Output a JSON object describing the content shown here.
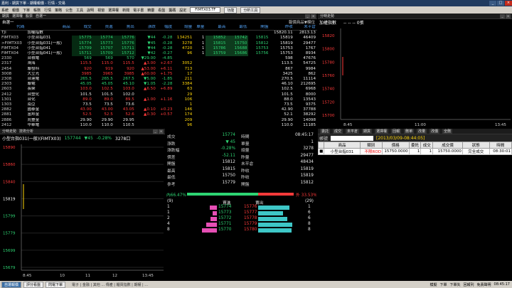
{
  "titlebar": {
    "title": "嘉利 - 期貨下單 - 期權報價 - 行情 - 交易"
  },
  "menubar": {
    "items": [
      "系統",
      "報價",
      "下單",
      "帳務",
      "行情",
      "策略",
      "公告",
      "工具",
      "說明",
      "視窗",
      "選擇權",
      "新聞",
      "電子書",
      "精靈",
      "看盤",
      "籌碼",
      "設定"
    ],
    "symbol": "FIMTX03.TF",
    "btn_a": "功能",
    "btn_b": "分析工具"
  },
  "quote": {
    "tabs": [
      "期貨",
      "選擇權",
      "股票",
      "自選一"
    ],
    "group": "自選一",
    "right_label": "報價商品▼欄位",
    "columns": [
      "代碼",
      "商品",
      "成交",
      "買進",
      "賣出",
      "漲跌",
      "幅度",
      "總量",
      "單量",
      "最高",
      "最低",
      "開盤",
      "昨收",
      "未平倉"
    ],
    "rows": [
      {
        "code": "TJI",
        "name": "加權指數",
        "price": "",
        "bid": "",
        "ask": "",
        "chg": "",
        "pct": "",
        "vol": "",
        "sv": "",
        "high": "",
        "low": "",
        "open": "",
        "prev": "15820.11",
        "oi": "2813.13",
        "cls": "wh",
        "hl": false
      },
      {
        "code": "FIMTX03",
        "name": "小型台指031",
        "price": "15775",
        "bid": "15774",
        "ask": "15776",
        "chg": "▼44",
        "pct": "-0.28",
        "vol": "134251",
        "sv": "1",
        "high": "15852",
        "low": "15742",
        "open": "15815",
        "prev": "15819",
        "oi": "46409",
        "cls": "dn",
        "hl": true
      },
      {
        "code": ">FIMTX03",
        "name": "小型台指031(一般)",
        "price": "15774",
        "bid": "15773",
        "ask": "15776",
        "chg": "▼45",
        "pct": "-0.28",
        "vol": "3278",
        "sv": "1",
        "high": "15815",
        "low": "15750",
        "open": "15812",
        "prev": "15819",
        "oi": "29477",
        "cls": "dn",
        "hl": true
      },
      {
        "code": "FIMTX04",
        "name": "小型台指041",
        "price": "15709",
        "bid": "15707",
        "ask": "15711",
        "chg": "▼44",
        "pct": "-0.28",
        "vol": "4720",
        "sv": "1",
        "high": "15786",
        "low": "15688",
        "open": "15753",
        "prev": "15753",
        "oi": "1767",
        "cls": "dn",
        "hl": true
      },
      {
        "code": "FIMTX04",
        "name": "小型台指041(一般)",
        "price": "15711",
        "bid": "15709",
        "ask": "15712",
        "chg": "▼42",
        "pct": "-0.27",
        "vol": "96",
        "sv": "1",
        "high": "15759",
        "low": "15686",
        "open": "15756",
        "prev": "15753",
        "oi": "8934",
        "cls": "dn",
        "hl": true
      },
      {
        "code": "2330",
        "name": "台積電",
        "price": "569",
        "bid": "569",
        "ask": "570",
        "chg": "▼29.00",
        "pct": "-4.85",
        "vol": "",
        "sv": "",
        "high": "",
        "low": "",
        "open": "",
        "prev": "598",
        "oi": "47676",
        "cls": "dn",
        "hl": false
      },
      {
        "code": "2317",
        "name": "鴻海",
        "price": "115.5",
        "bid": "115.0",
        "ask": "115.5",
        "chg": "▲3.00",
        "pct": "+2.67",
        "vol": "3052",
        "sv": "",
        "high": "",
        "low": "",
        "open": "",
        "prev": "113.5",
        "oi": "54725",
        "cls": "up",
        "hl": false
      },
      {
        "code": "2454",
        "name": "聯發科",
        "price": "920",
        "bid": "919",
        "ask": "920",
        "chg": "▲53.00",
        "pct": "+6.11",
        "vol": "713",
        "sv": "",
        "high": "",
        "low": "",
        "open": "",
        "prev": "867",
        "oi": "9984",
        "cls": "up",
        "hl": false
      },
      {
        "code": "3008",
        "name": "大立光",
        "price": "3985",
        "bid": "3965",
        "ask": "3985",
        "chg": "▲60.00",
        "pct": "+1.75",
        "vol": "17",
        "sv": "",
        "high": "",
        "low": "",
        "open": "",
        "prev": "3425",
        "oi": "862",
        "cls": "up",
        "hl": false
      },
      {
        "code": "2308",
        "name": "台達電",
        "price": "265.5",
        "bid": "265.5",
        "ask": "267.5",
        "chg": "▼5.00",
        "pct": "-1.85",
        "vol": "211",
        "sv": "",
        "high": "",
        "low": "",
        "open": "",
        "prev": "270.5",
        "oi": "11114",
        "cls": "dn",
        "hl": false
      },
      {
        "code": "2303",
        "name": "聯電",
        "price": "45.05",
        "bid": "45.05",
        "ask": "45.10",
        "chg": "▼1.05",
        "pct": "-2.28",
        "vol": "3384",
        "sv": "",
        "high": "",
        "low": "",
        "open": "",
        "prev": "46.10",
        "oi": "212695",
        "cls": "dn",
        "hl": false
      },
      {
        "code": "2603",
        "name": "長榮",
        "price": "103.0",
        "bid": "102.5",
        "ask": "103.0",
        "chg": "▲6.50",
        "pct": "+6.89",
        "vol": "63",
        "sv": "",
        "high": "",
        "low": "",
        "open": "",
        "prev": "102.5",
        "oi": "6968",
        "cls": "up",
        "hl": false
      },
      {
        "code": "2412",
        "name": "台塑化",
        "price": "101.5",
        "bid": "101.5",
        "ask": "102.0",
        "chg": "",
        "pct": "",
        "vol": "29",
        "sv": "",
        "high": "",
        "low": "",
        "open": "",
        "prev": "101.5",
        "oi": "8000",
        "cls": "wh",
        "hl": false
      },
      {
        "code": "1301",
        "name": "台化",
        "price": "89.0",
        "bid": "89.0",
        "ask": "89.5",
        "chg": "▲1.00",
        "pct": "+1.16",
        "vol": "106",
        "sv": "",
        "high": "",
        "low": "",
        "open": "",
        "prev": "88.0",
        "oi": "13543",
        "cls": "up",
        "hl": false
      },
      {
        "code": "1303",
        "name": "南亞",
        "price": "73.5",
        "bid": "73.5",
        "ask": "73.6",
        "chg": "",
        "pct": "",
        "vol": "1",
        "sv": "",
        "high": "",
        "low": "",
        "open": "",
        "prev": "73.5",
        "oi": "9375",
        "cls": "wh",
        "hl": false
      },
      {
        "code": "2882",
        "name": "國泰金",
        "price": "43.00",
        "bid": "43.00",
        "ask": "43.05",
        "chg": "▲0.10",
        "pct": "+0.23",
        "vol": "146",
        "sv": "",
        "high": "",
        "low": "",
        "open": "",
        "prev": "42.90",
        "oi": "37788",
        "cls": "up",
        "hl": false
      },
      {
        "code": "2881",
        "name": "富邦金",
        "price": "52.5",
        "bid": "52.5",
        "ask": "52.6",
        "chg": "▲0.30",
        "pct": "+0.57",
        "vol": "174",
        "sv": "",
        "high": "",
        "low": "",
        "open": "",
        "prev": "52.1",
        "oi": "38292",
        "cls": "up",
        "hl": false
      },
      {
        "code": "2886",
        "name": "兆豐金",
        "price": "29.90",
        "bid": "29.90",
        "ask": "29.95",
        "chg": "",
        "pct": "",
        "vol": "209",
        "sv": "",
        "high": "",
        "low": "",
        "open": "",
        "prev": "29.90",
        "oi": "14098",
        "cls": "wh",
        "hl": false
      },
      {
        "code": "2412",
        "name": "中華電",
        "price": "110.0",
        "bid": "110.0",
        "ask": "110.5",
        "chg": "",
        "pct": "",
        "vol": "96",
        "sv": "",
        "high": "",
        "low": "",
        "open": "",
        "prev": "110.0",
        "oi": "11185",
        "cls": "wh",
        "hl": false
      }
    ]
  },
  "toppanel": {
    "tab": "分時走勢",
    "name": "加權指數",
    "values": "-- -- -- 0張",
    "ylabels": [
      "15820",
      "15800",
      "15780",
      "15760",
      "15740",
      "15720",
      "15700"
    ],
    "xlabels": [
      "8:45",
      "11:00",
      "13:45"
    ]
  },
  "mini": {
    "tabs": [
      "分時走勢",
      "技術分析"
    ],
    "product": "小型台指031(一般)(FIMTX03)",
    "price": "157744",
    "change": "▼45",
    "pct": "-0.28%",
    "volume": "3278口",
    "ylabels": [
      "15890",
      "15860",
      "15840",
      "15819",
      "15799",
      "15779",
      "15699",
      "15679"
    ],
    "xlabels": [
      "8:45",
      "10",
      "11",
      "12",
      "13:45"
    ]
  },
  "tick": {
    "stats_left": [
      {
        "label": "成交",
        "value": "15774"
      },
      {
        "label": "漲跌",
        "value": "▼ 45"
      },
      {
        "label": "漲跌幅",
        "value": "-0.28%"
      },
      {
        "label": "價差",
        "value": "-52.11"
      },
      {
        "label": "開盤",
        "value": "15812"
      },
      {
        "label": "最高",
        "value": "15815"
      },
      {
        "label": "最低",
        "value": "15750"
      },
      {
        "label": "參考",
        "value": "15779"
      }
    ],
    "stats_right": [
      {
        "label": "時間",
        "value": "08:45:17"
      },
      {
        "label": "單量",
        "value": "1"
      },
      {
        "label": "總量",
        "value": "3278"
      },
      {
        "label": "昨量",
        "value": "29477"
      },
      {
        "label": "未平倉",
        "value": "48434"
      },
      {
        "label": "昨收",
        "value": "15819"
      },
      {
        "label": "昨收",
        "value": "15819"
      },
      {
        "label": "開盤",
        "value": "15812"
      }
    ],
    "inner": "內66.47%",
    "outer": "外 33.53%",
    "book_header_left": "(9)",
    "book_header_mid_bid": "買進",
    "book_header_mid_ask": "賣出",
    "book_header_right": "(29)",
    "book": [
      {
        "bq": "1",
        "bp": "15774",
        "ap": "15776",
        "aq": "1",
        "bw": 20,
        "aw": 58
      },
      {
        "bq": "1",
        "bp": "15773",
        "ap": "15777",
        "aq": "6",
        "bw": 12,
        "aw": 46
      },
      {
        "bq": "2",
        "bp": "15772",
        "ap": "15778",
        "aq": "6",
        "bw": 18,
        "aw": 54
      },
      {
        "bq": "4",
        "bp": "15771",
        "ap": "15779",
        "aq": "8",
        "bw": 30,
        "aw": 64
      },
      {
        "bq": "8",
        "bp": "15770",
        "ap": "15780",
        "aq": "8",
        "bw": 42,
        "aw": 62
      }
    ]
  },
  "orders": {
    "toolbar": [
      "委託",
      "成交",
      "未平倉",
      "期貨",
      "選擇權",
      "回報",
      "刪單",
      "改量",
      "改價",
      "全刪"
    ],
    "account": "帳號",
    "acct_value": "[2013/03/09-08:44:05]",
    "columns": [
      "",
      "商品",
      "類別",
      "價格",
      "委託",
      "成交",
      "成交價",
      "狀態",
      "時間"
    ],
    "rows": [
      {
        "chk": "■",
        "product": "小型台指031",
        "type": "不限ROD",
        "price": "15750.0000",
        "qty": "1",
        "filled": "1",
        "fillprice": "15750.0000",
        "status": "完全成交",
        "time": "08:30:01"
      }
    ]
  },
  "statusbar": {
    "tabs": [
      "自選報價",
      "評分看盤",
      "閃電下單"
    ],
    "ticker": "電子 | 金融 | 其他 ... 傳產 | 櫃買指數 | 期權 | ...",
    "right": [
      "模擬",
      "下單",
      "下單失",
      "回報列",
      "免責聲明",
      "08:45:17"
    ]
  }
}
